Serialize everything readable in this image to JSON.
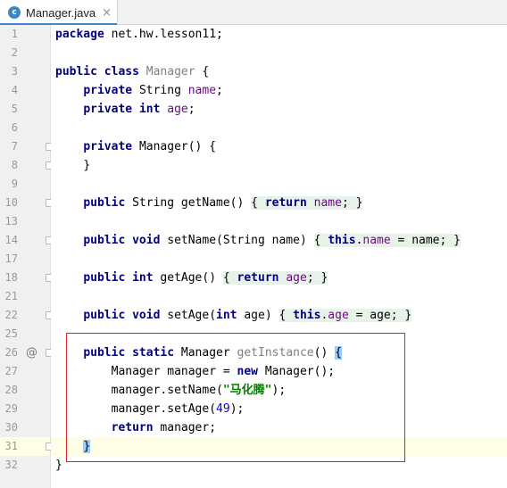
{
  "tab": {
    "icon_letter": "c",
    "title": "Manager.java",
    "close": "×",
    "icon_color": "#3d86c6"
  },
  "gutter": {
    "line_numbers": [
      "1",
      "2",
      "3",
      "4",
      "5",
      "6",
      "7",
      "8",
      "9",
      "10",
      "13",
      "14",
      "17",
      "18",
      "21",
      "22",
      "25",
      "26",
      "27",
      "28",
      "29",
      "30",
      "31",
      "32"
    ],
    "override_marker": "@"
  },
  "code": {
    "package_kw": "package",
    "package_name": " net.hw.lesson11;",
    "public": "public",
    "class": "class",
    "class_name": "Manager",
    "brace_open": " {",
    "private": "private",
    "string_type": "String",
    "int_type": "int",
    "field_name": "name",
    "field_age": "age",
    "constructor": "Manager() {",
    "close_brace": "}",
    "void": "void",
    "return": "return",
    "this": "this",
    "static": "static",
    "new": "new",
    "get_name_sig": " String getName() ",
    "set_name_sig": " setName(String name) ",
    "get_age_sig": " getAge() ",
    "set_age_sig": " setAge(",
    "set_age_param": " age) ",
    "lbrace": "{",
    "rbrace": "}",
    "eq_name": " = name; ",
    "eq_age": " = age; ",
    "get_instance_type": " Manager ",
    "get_instance_name": "getInstance",
    "get_instance_tail": "() ",
    "line27": "Manager manager = ",
    "line27_tail": " Manager();",
    "line28_head": "manager.setName(",
    "line28_str": "\"马化腾\"",
    "line28_tail": ");",
    "line29_head": "manager.setAge(",
    "line29_num": "49",
    "line29_tail": ");",
    "line30_tail": " manager;",
    "final_brace": "}"
  },
  "colors": {
    "keyword": "#000080",
    "field": "#660e7a",
    "string": "#008000",
    "number": "#0000ff",
    "highlight_box": "#d9202a"
  }
}
